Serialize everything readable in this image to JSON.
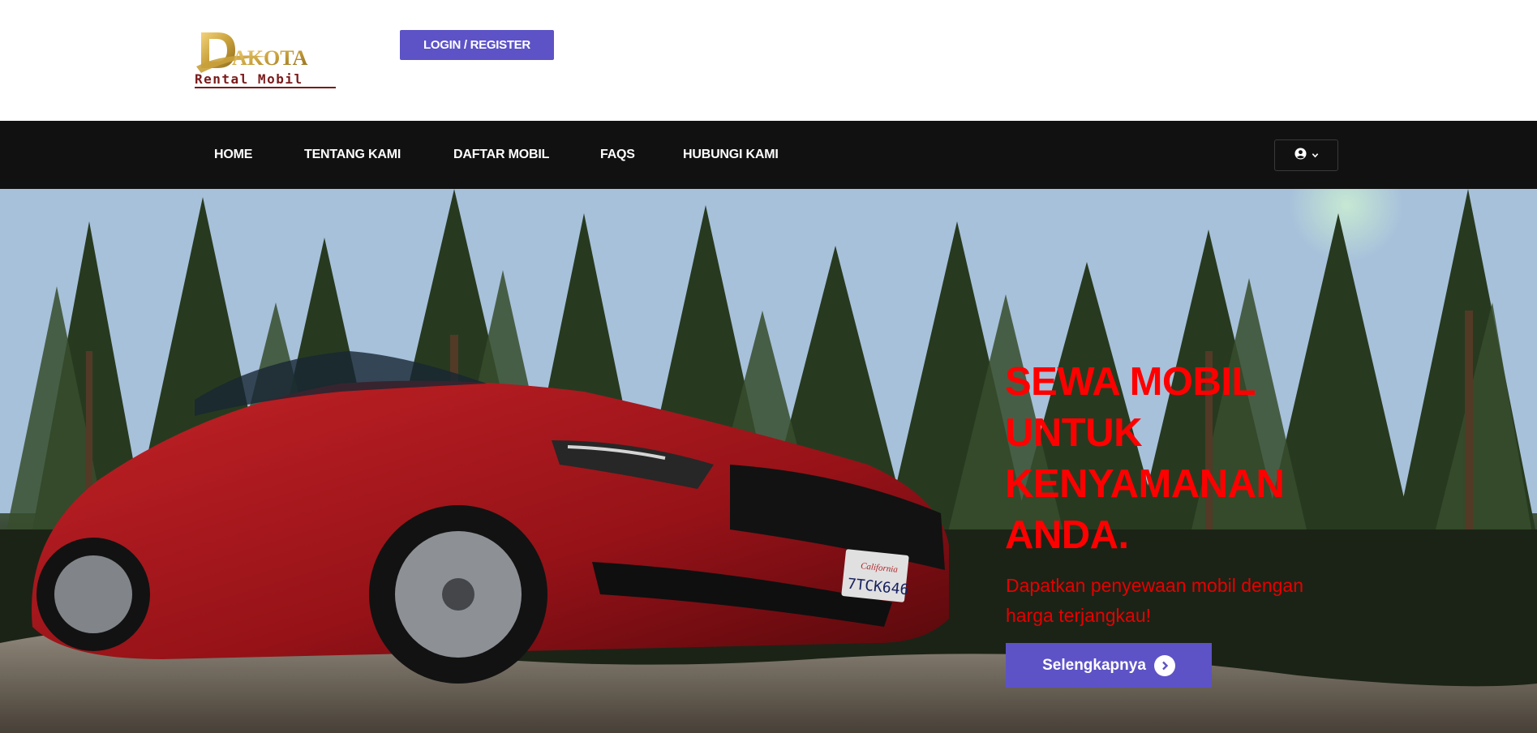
{
  "brand": {
    "logo_letter": "D",
    "logo_word": "AKOTA",
    "logo_tagline": "Rental Mobil"
  },
  "header": {
    "login_label": "LOGIN / REGISTER"
  },
  "nav": {
    "items": [
      {
        "label": "HOME"
      },
      {
        "label": "TENTANG KAMI"
      },
      {
        "label": "DAFTAR MOBIL"
      },
      {
        "label": "FAQS"
      },
      {
        "label": "HUBUNGI KAMI"
      }
    ],
    "user_icon": "user-circle-icon",
    "dropdown_icon": "chevron-down-icon"
  },
  "hero": {
    "title_lines": [
      "SEWA MOBIL",
      "UNTUK",
      "KENYAMANAN",
      "ANDA."
    ],
    "subtitle_lines": [
      "Dapatkan penyewaan mobil dengan",
      "harga terjangkau!"
    ],
    "cta_label": "Selengkapnya",
    "cta_icon": "chevron-right-circle-icon",
    "plate_state": "California",
    "plate_number": "7TCK646"
  },
  "colors": {
    "accent": "#5d53c6",
    "navbar_bg": "#111111",
    "hero_title": "#ff0000",
    "logo_gold": "#c9a13b",
    "logo_maroon": "#7a1a1a"
  }
}
